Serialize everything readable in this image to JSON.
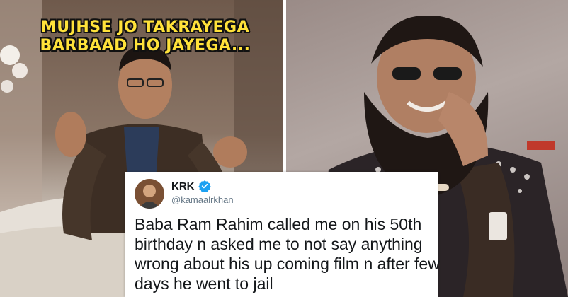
{
  "caption": {
    "line1": "MUJHSE JO TAKRAYEGA",
    "line2": "BARBAAD HO JAYEGA..."
  },
  "tweet": {
    "name": "KRK",
    "handle": "@kamaalrkhan",
    "lines": [
      "Baba Ram Rahim called me on his 50th",
      "birthday n asked me to not say anything",
      "wrong about his up coming film n after few",
      "days he went to jail"
    ]
  },
  "colors": {
    "caption": "#ffe23a",
    "verified": "#1da1f2",
    "tweet_text": "#14171a",
    "handle": "#657786"
  },
  "icons": {
    "verified": "verified-badge-icon",
    "avatar": "profile-avatar"
  }
}
